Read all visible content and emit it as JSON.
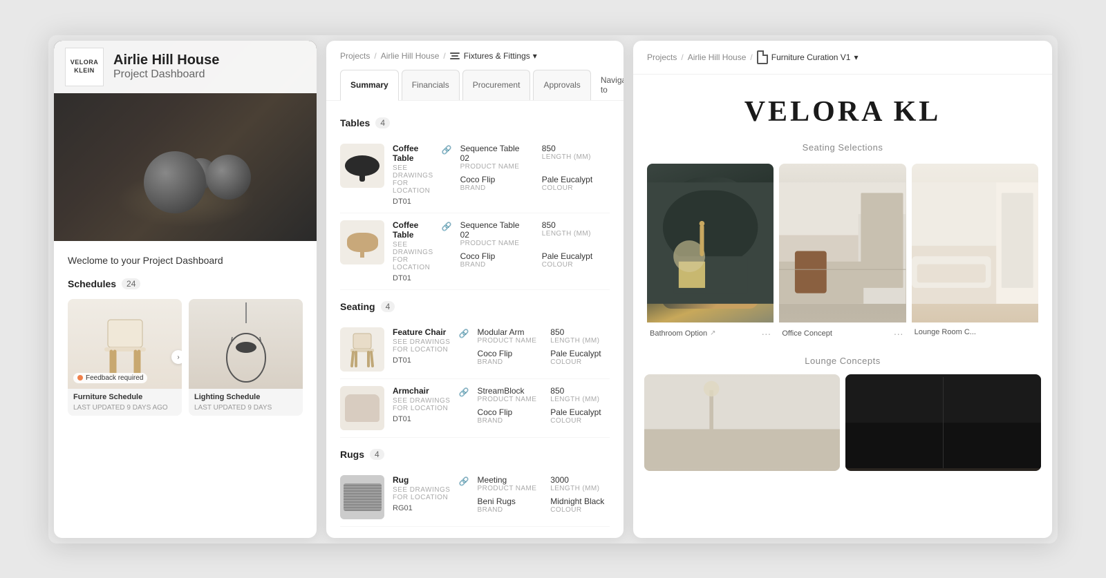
{
  "dashboard": {
    "logo_text": "VELORA KLEIN",
    "project_name": "Airlie Hill House",
    "project_sub": "Project Dashboard",
    "welcome_text": "Weclome to your Project Dashboard",
    "schedules_label": "Schedules",
    "schedules_count": "24",
    "furniture_schedule_label": "Furniture Schedule",
    "furniture_schedule_date": "LAST UPDATED 9 DAYS AGO",
    "lighting_schedule_label": "Lighting Schedule",
    "lighting_schedule_date": "LAST UPDATED 9 DAYS",
    "feedback_label": "Feedback required"
  },
  "fixtures": {
    "breadcrumb_projects": "Projects",
    "breadcrumb_project": "Airlie Hill House",
    "breadcrumb_active": "Fixtures & Fittings",
    "tab_summary": "Summary",
    "tab_financials": "Financials",
    "tab_procurement": "Procurement",
    "tab_approvals": "Approvals",
    "tab_navigate": "Navigate to",
    "tables_label": "Tables",
    "tables_count": "4",
    "seating_label": "Seating",
    "seating_count": "4",
    "rugs_label": "Rugs",
    "rugs_count": "4",
    "items": [
      {
        "category": "tables",
        "name": "Coffee Table",
        "sublabel": "SEE DRAWINGS FOR LOCATION",
        "code": "DT01",
        "product_name": "Sequence Table 02",
        "product_name_key": "PRODUCT NAME",
        "brand": "Coco Flip",
        "brand_key": "BRAND",
        "length": "850",
        "length_key": "LENGTH (MM)",
        "colour": "Pale Eucalypt",
        "colour_key": "COLOUR"
      },
      {
        "category": "tables",
        "name": "Coffee Table",
        "sublabel": "SEE DRAWINGS FOR LOCATION",
        "code": "DT01",
        "product_name": "Sequence Table 02",
        "product_name_key": "PRODUCT NAME",
        "brand": "Coco Flip",
        "brand_key": "BRAND",
        "length": "850",
        "length_key": "LENGTH (MM)",
        "colour": "Pale Eucalypt",
        "colour_key": "COLOUR"
      },
      {
        "category": "seating",
        "name": "Feature Chair",
        "sublabel": "SEE DRAWINGS FOR LOCATION",
        "code": "DT01",
        "product_name": "Modular Arm",
        "product_name_key": "PRODUCT NAME",
        "brand": "Coco Flip",
        "brand_key": "BRAND",
        "length": "850",
        "length_key": "LENGTH (MM)",
        "colour": "Pale Eucalypt",
        "colour_key": "COLOUR"
      },
      {
        "category": "seating",
        "name": "Armchair",
        "sublabel": "SEE DRAWINGS FOR LOCATION",
        "code": "DT01",
        "product_name": "StreamBlock",
        "product_name_key": "PRODUCT NAME",
        "brand": "Coco Flip",
        "brand_key": "BRAND",
        "length": "850",
        "length_key": "LENGTH (MM)",
        "colour": "Pale Eucalypt",
        "colour_key": "COLOUR"
      },
      {
        "category": "rugs",
        "name": "Rug",
        "sublabel": "SEE DRAWINGS FOR LOCATION",
        "code": "RG01",
        "product_name": "Meeting",
        "product_name_key": "PRODUCT NAME",
        "brand": "Beni Rugs",
        "brand_key": "BRAND",
        "length": "3000",
        "length_key": "LENGTH (MM)",
        "colour": "Midnight Black",
        "colour_key": "COLOUR"
      }
    ]
  },
  "curation": {
    "breadcrumb_projects": "Projects",
    "breadcrumb_project": "Airlie Hill House",
    "breadcrumb_active": "Furniture Curation V1",
    "brand_name": "VELORA KL",
    "seating_section": "Seating Selections",
    "lounge_section": "Lounge Concepts",
    "bathroom_label": "Bathroom Option",
    "office_label": "Office Concept",
    "lounge_label": "Lounge Room C..."
  }
}
